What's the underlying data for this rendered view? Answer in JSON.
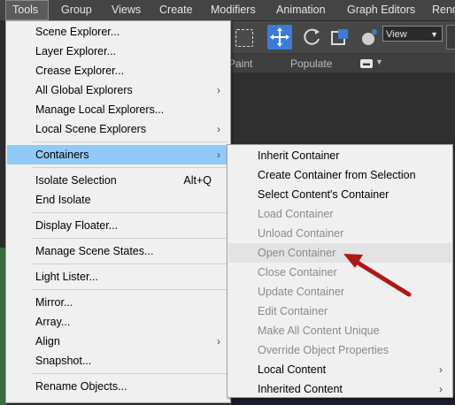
{
  "menubar": {
    "items": [
      {
        "label": "Tools"
      },
      {
        "label": "Group"
      },
      {
        "label": "Views"
      },
      {
        "label": "Create"
      },
      {
        "label": "Modifiers"
      },
      {
        "label": "Animation"
      },
      {
        "label": "Graph Editors"
      },
      {
        "label": "Rend"
      }
    ]
  },
  "toolbar": {
    "view_select": "View"
  },
  "ribbon": {
    "paint": "Paint",
    "populate": "Populate"
  },
  "tools_menu": {
    "items": [
      {
        "label": "Scene Explorer..."
      },
      {
        "label": "Layer Explorer..."
      },
      {
        "label": "Crease Explorer..."
      },
      {
        "label": "All Global Explorers"
      },
      {
        "label": "Manage Local Explorers..."
      },
      {
        "label": "Local Scene Explorers"
      },
      {
        "label": "Containers"
      },
      {
        "label": "Isolate Selection",
        "shortcut": "Alt+Q"
      },
      {
        "label": "End Isolate"
      },
      {
        "label": "Display Floater..."
      },
      {
        "label": "Manage Scene States..."
      },
      {
        "label": "Light Lister..."
      },
      {
        "label": "Mirror..."
      },
      {
        "label": "Array..."
      },
      {
        "label": "Align"
      },
      {
        "label": "Snapshot..."
      },
      {
        "label": "Rename Objects..."
      }
    ]
  },
  "containers_menu": {
    "items": [
      {
        "label": "Inherit Container"
      },
      {
        "label": "Create Container from Selection"
      },
      {
        "label": "Select Content's Container"
      },
      {
        "label": "Load Container"
      },
      {
        "label": "Unload Container"
      },
      {
        "label": "Open Container"
      },
      {
        "label": "Close Container"
      },
      {
        "label": "Update Container"
      },
      {
        "label": "Edit Container"
      },
      {
        "label": "Make All Content Unique"
      },
      {
        "label": "Override Object Properties"
      },
      {
        "label": "Local Content"
      },
      {
        "label": "Inherited Content"
      }
    ]
  },
  "colors": {
    "highlight": "#91c9f7",
    "annotation_arrow": "#b01818",
    "active_tool": "#3d7bd8"
  }
}
